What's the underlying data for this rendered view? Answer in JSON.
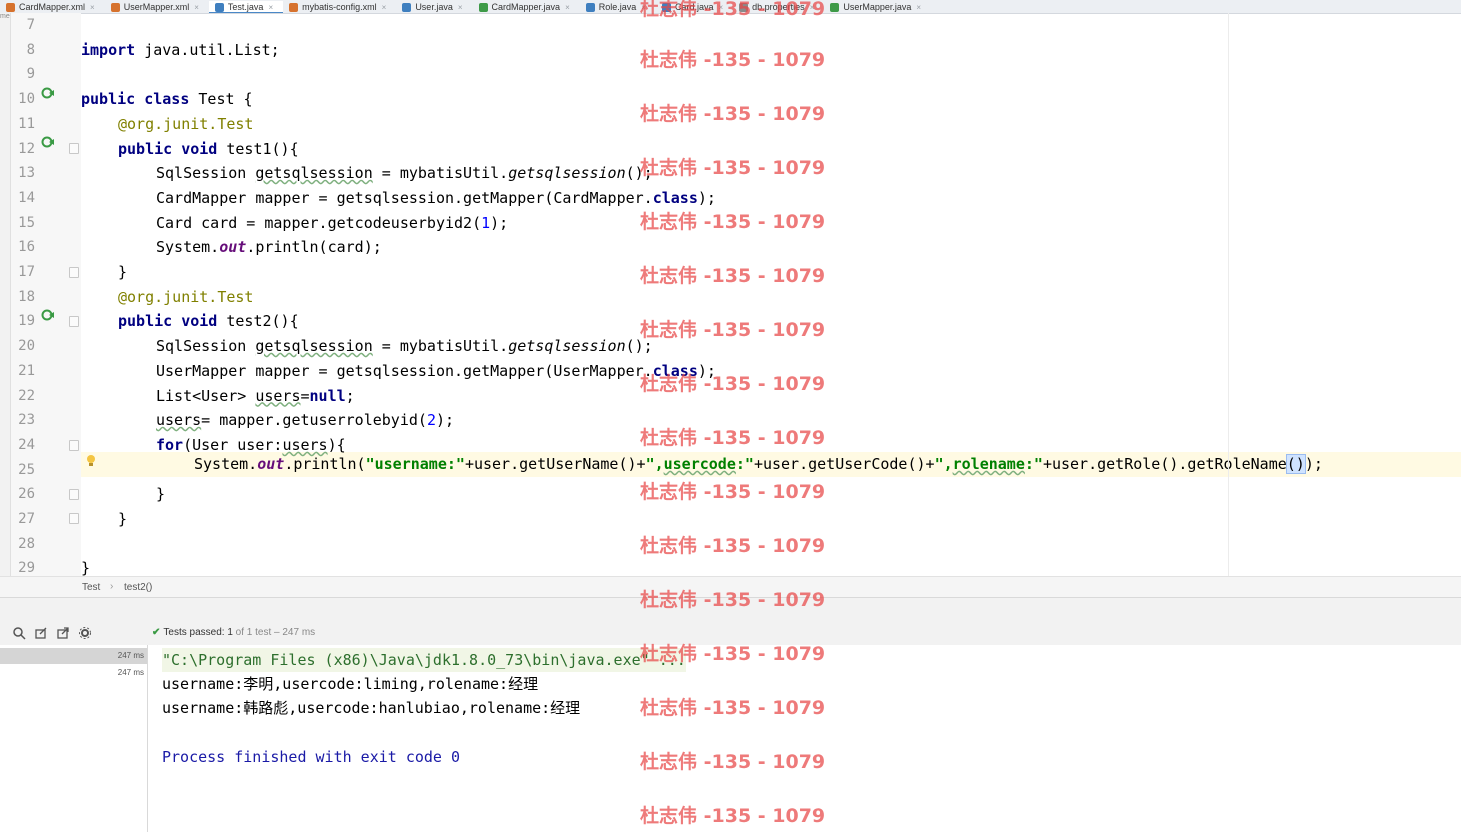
{
  "tabs": [
    {
      "label": "CardMapper.xml",
      "color": "#d6722e"
    },
    {
      "label": "UserMapper.xml",
      "color": "#d6722e"
    },
    {
      "label": "Test.java",
      "color": "#3f7fbf",
      "active": true
    },
    {
      "label": "mybatis-config.xml",
      "color": "#d6722e"
    },
    {
      "label": "User.java",
      "color": "#3f7fbf"
    },
    {
      "label": "CardMapper.java",
      "color": "#3e9a48"
    },
    {
      "label": "Role.java",
      "color": "#3f7fbf"
    },
    {
      "label": "Card.java",
      "color": "#3f7fbf"
    },
    {
      "label": "db.properties",
      "color": "#8a8a8a"
    },
    {
      "label": "UserMapper.java",
      "color": "#3e9a48"
    }
  ],
  "left_strip_label": "me",
  "line_numbers": [
    "7",
    "8",
    "9",
    "10",
    "11",
    "12",
    "13",
    "14",
    "15",
    "16",
    "17",
    "18",
    "19",
    "20",
    "21",
    "22",
    "23",
    "24",
    "25",
    "26",
    "27",
    "28",
    "29"
  ],
  "code": {
    "l8": {
      "kw": "import",
      "rest": " java.util.List;"
    },
    "l10": {
      "kw1": "public",
      "kw2": "class",
      "rest": " Test {"
    },
    "l11": {
      "at": "@org.junit.",
      "ann": "Test"
    },
    "l12": {
      "kw1": "public",
      "kw2": "void",
      "rest": " test1(){"
    },
    "l13": {
      "a": "SqlSession ",
      "var": "getsqlsession",
      "b": " = mybatisUtil.",
      "m": "getsqlsession",
      "c": "();"
    },
    "l14": {
      "a": "CardMapper mapper = getsqlsession.getMapper(CardMapper.",
      "kw": "class",
      "b": ");"
    },
    "l15": {
      "a": "Card card = mapper.getcodeuserbyid2(",
      "num": "1",
      "b": ");"
    },
    "l16": {
      "a": "System.",
      "field": "out",
      "b": ".println(card);"
    },
    "l17": {
      "rest": "}"
    },
    "l18": {
      "at": "@org.junit.",
      "ann": "Test"
    },
    "l19": {
      "kw1": "public",
      "kw2": "void",
      "rest": " test2(){"
    },
    "l20": {
      "a": "SqlSession ",
      "var": "getsqlsession",
      "b": " = mybatisUtil.",
      "m": "getsqlsession",
      "c": "();"
    },
    "l21": {
      "a": "UserMapper mapper = getsqlsession.getMapper(UserMapper.",
      "kw": "class",
      "b": ");"
    },
    "l22": {
      "a": "List<User> ",
      "var": "users",
      "b": "=",
      "kw": "null",
      "c": ";"
    },
    "l23": {
      "var": "users",
      "a": "= mapper.getuserrolebyid(",
      "num": "2",
      "b": ");"
    },
    "l24": {
      "kw": "for",
      "a": "(User user:",
      "var": "users",
      "b": "){"
    },
    "l25": {
      "a": "System.",
      "field": "out",
      "b": ".println(",
      "s1": "\"username:\"",
      "c": "+user.getUserName()+",
      "s2": "\",",
      "s2u": "usercode",
      "s2e": ":\"",
      "d": "+user.getUserCode()+",
      "s3": "\",",
      "s3u": "rolename",
      "s3e": ":\"",
      "e": "+user.getRole().getRoleName",
      "p": "()",
      "f": ");"
    },
    "l26": {
      "rest": "}"
    },
    "l27": {
      "rest": "}"
    },
    "l29": {
      "rest": "}"
    }
  },
  "breadcrumb": {
    "class_name": "Test",
    "separator": "›",
    "method": "test2()"
  },
  "test_status": {
    "passed_label": "Tests passed:",
    "passed_count": "1",
    "of_text": "of 1 test – 247 ms"
  },
  "test_tree": {
    "duration1": "247 ms",
    "duration2": "247 ms"
  },
  "console": {
    "command": "\"C:\\Program Files (x86)\\Java\\jdk1.8.0_73\\bin\\java.exe\" ...",
    "out1": "username:李明,usercode:liming,rolename:经理",
    "out2": "username:韩路彪,usercode:hanlubiao,rolename:经理",
    "exit": "Process finished with exit code 0"
  },
  "watermark": "杜志伟 -135 - 1079",
  "colors": {
    "keyword": "#000080",
    "string": "#008000",
    "number": "#0000ff",
    "annotation": "#808000",
    "field": "#660e7a",
    "watermark": "#e84646"
  }
}
